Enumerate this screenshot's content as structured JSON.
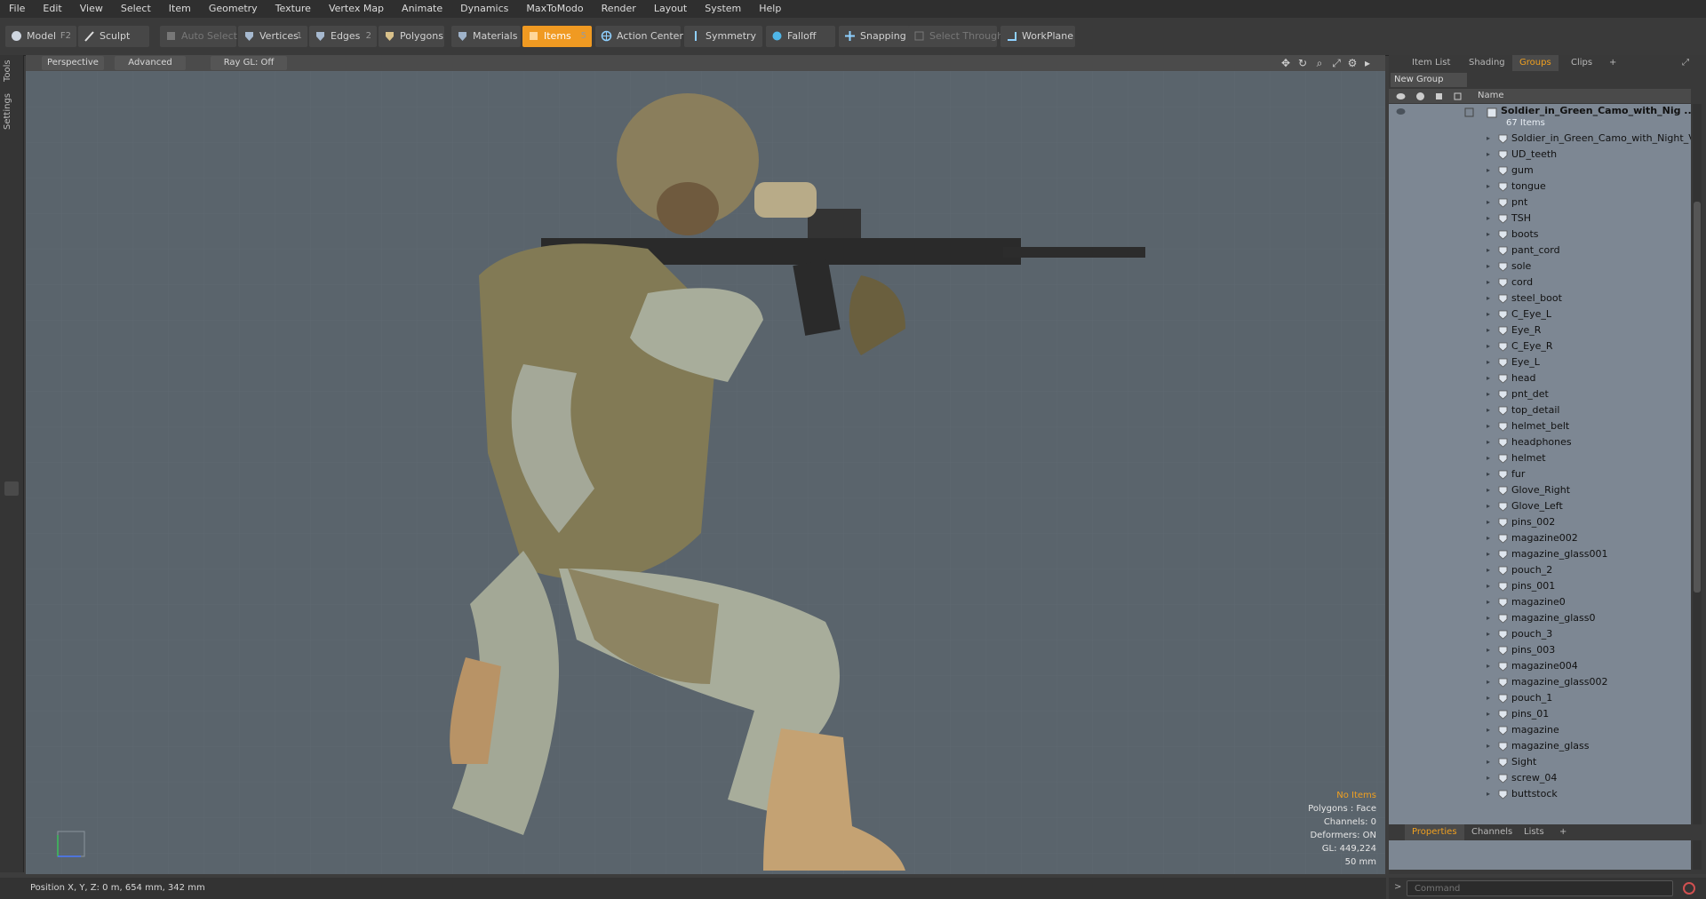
{
  "menubar": [
    "File",
    "Edit",
    "View",
    "Select",
    "Item",
    "Geometry",
    "Texture",
    "Vertex Map",
    "Animate",
    "Dynamics",
    "MaxToModo",
    "Render",
    "Layout",
    "System",
    "Help"
  ],
  "toolbar": {
    "model": "Model",
    "model_key": "F2",
    "sculpt": "Sculpt",
    "auto_select": "Auto Select",
    "vertices": "Vertices",
    "vertices_key": "1",
    "edges": "Edges",
    "edges_key": "2",
    "polygons": "Polygons",
    "materials": "Materials",
    "items": "Items",
    "items_key": "5",
    "action_center": "Action Center",
    "symmetry": "Symmetry",
    "falloff": "Falloff",
    "snapping": "Snapping",
    "select_through": "Select Through",
    "workplane": "WorkPlane",
    "accent": "#f09a22"
  },
  "leftstrip": {
    "tools": "Tools",
    "settings": "Settings"
  },
  "viewport": {
    "perspective": "Perspective",
    "advanced": "Advanced",
    "raygl": "Ray GL: Off",
    "info": {
      "no_items": "No Items",
      "polygons": "Polygons : Face",
      "channels": "Channels: 0",
      "deformers": "Deformers: ON",
      "gl": "GL: 449,224",
      "focal": "50 mm"
    },
    "bg_color": "#5a646c"
  },
  "rightpanel": {
    "tabs": [
      "Item List",
      "Shading",
      "Groups",
      "Clips"
    ],
    "active_tab": "Groups",
    "new_group": "New Group",
    "name_header": "Name",
    "group_name": "Soldier_in_Green_Camo_with_Nig ...",
    "group_count": "67 Items",
    "items": [
      "Soldier_in_Green_Camo_with_Night_V...",
      "UD_teeth",
      "gum",
      "tongue",
      "pnt",
      "TSH",
      "boots",
      "pant_cord",
      "sole",
      "cord",
      "steel_boot",
      "C_Eye_L",
      "Eye_R",
      "C_Eye_R",
      "Eye_L",
      "head",
      "pnt_det",
      "top_detail",
      "helmet_belt",
      "headphones",
      "helmet",
      "fur",
      "Glove_Right",
      "Glove_Left",
      "pins_002",
      "magazine002",
      "magazine_glass001",
      "pouch_2",
      "pins_001",
      "magazine0",
      "magazine_glass0",
      "pouch_3",
      "pins_003",
      "magazine004",
      "magazine_glass002",
      "pouch_1",
      "pins_01",
      "magazine",
      "magazine_glass",
      "Sight",
      "screw_04",
      "buttstock"
    ]
  },
  "bottom_tabs": [
    "Properties",
    "Channels",
    "Lists"
  ],
  "status": {
    "position": "Position X, Y, Z:   0 m, 654 mm, 342 mm"
  },
  "command": {
    "placeholder": "Command"
  }
}
